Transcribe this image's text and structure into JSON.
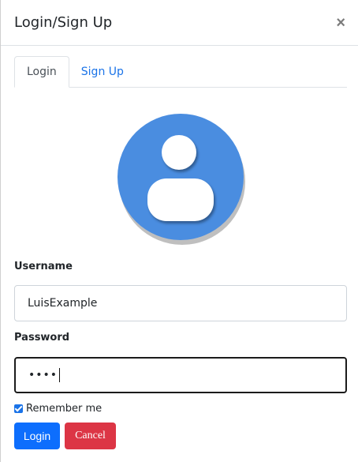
{
  "modal": {
    "title": "Login/Sign Up",
    "close_symbol": "×"
  },
  "tabs": [
    {
      "label": "Login",
      "active": true
    },
    {
      "label": "Sign Up",
      "active": false
    }
  ],
  "avatar": {
    "icon": "user-icon",
    "color": "#4a8de0"
  },
  "form": {
    "username_label": "Username",
    "username_value": "LuisExample",
    "password_label": "Password",
    "password_masked": "••••",
    "remember_label": "Remember me",
    "remember_checked": true
  },
  "buttons": {
    "login": "Login",
    "cancel": "Cancel"
  },
  "colors": {
    "primary": "#0d6efd",
    "danger": "#dc3545",
    "link": "#1a73e8"
  }
}
